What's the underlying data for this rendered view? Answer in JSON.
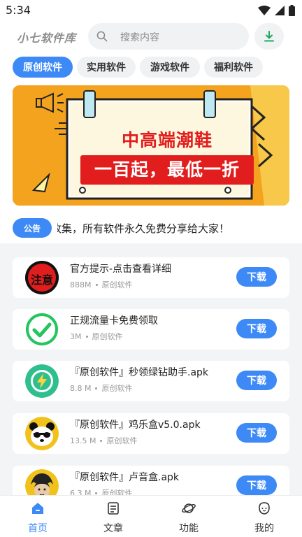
{
  "status": {
    "time": "5:34"
  },
  "header": {
    "title": "小七软件库",
    "search_placeholder": "搜索内容"
  },
  "tabs": [
    {
      "label": "原创软件",
      "active": true
    },
    {
      "label": "实用软件",
      "active": false
    },
    {
      "label": "游戏软件",
      "active": false
    },
    {
      "label": "福利软件",
      "active": false
    }
  ],
  "banner": {
    "line1": "中高端潮鞋",
    "line2": "一百起，最低一折"
  },
  "notice": {
    "badge": "公告",
    "text": "软件库收集，所有软件永久免费分享给大家！"
  },
  "apps": [
    {
      "title": "官方提示-点击查看详细",
      "size": "888M",
      "category": "原创软件",
      "icon": "notice-icon",
      "icon_text": "注意",
      "button": "下载"
    },
    {
      "title": "正规流量卡免费领取",
      "size": "3M",
      "category": "原创软件",
      "icon": "check-icon",
      "button": "下载"
    },
    {
      "title": "『原创软件』秒领绿钻助手.apk",
      "size": "8.8 M",
      "category": "原创软件",
      "icon": "green-diamond-icon",
      "button": "下载"
    },
    {
      "title": "『原创软件』鸡乐盒v5.0.apk",
      "size": "13.5 M",
      "category": "原创软件",
      "icon": "panda-icon",
      "button": "下载"
    },
    {
      "title": "『原创软件』卢音盒.apk",
      "size": "6.3 M",
      "category": "原创软件",
      "icon": "avatar-icon",
      "button": "下载"
    }
  ],
  "nav": [
    {
      "label": "首页",
      "icon": "home-icon",
      "active": true
    },
    {
      "label": "文章",
      "icon": "article-icon",
      "active": false
    },
    {
      "label": "功能",
      "icon": "planet-icon",
      "active": false
    },
    {
      "label": "我的",
      "icon": "face-icon",
      "active": false
    }
  ],
  "colors": {
    "accent": "#3d8af7",
    "banner_bg": "#f4a31f",
    "banner_red": "#e21d1d",
    "check_green": "#22c55e"
  }
}
